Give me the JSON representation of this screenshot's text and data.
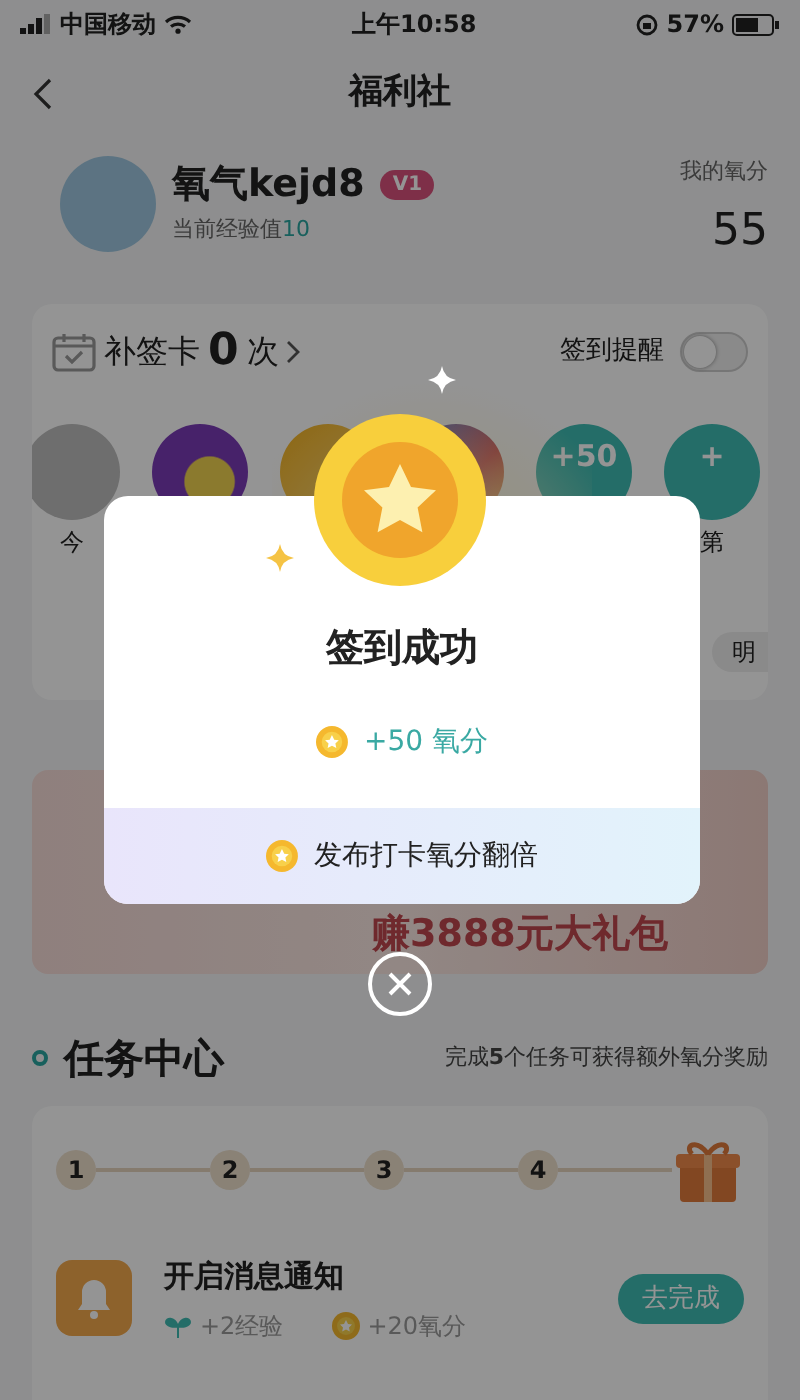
{
  "status_bar": {
    "carrier": "中国移动",
    "time": "上午10:58",
    "battery": "57%"
  },
  "nav": {
    "title": "福利社"
  },
  "profile": {
    "name": "氧气kejd8",
    "badge": "V1",
    "exp_label": "当前经验值",
    "exp_value": "10",
    "points_label": "我的氧分",
    "points": "55"
  },
  "checkin": {
    "makeup_label": "补签卡",
    "makeup_count": "0",
    "makeup_unit": "次",
    "reminder_label": "签到提醒",
    "reminder_on": false,
    "days": [
      {
        "kind": "gray",
        "label": "今"
      },
      {
        "kind": "purple"
      },
      {
        "kind": "coin"
      },
      {
        "kind": "colorful"
      },
      {
        "kind": "teal",
        "text": "+50"
      },
      {
        "kind": "teal",
        "text": "+",
        "label": "第"
      }
    ],
    "rules_chip": "明"
  },
  "banner": {
    "text": "赚3888元大礼包"
  },
  "tasks": {
    "title": "任务中心",
    "hint": "完成**5**个任务可获得额外氧分奖励",
    "steps": [
      "1",
      "2",
      "3",
      "4"
    ],
    "items": [
      {
        "title": "开启消息通知",
        "exp": "+2经验",
        "points": "+20氧分",
        "action": "去完成"
      }
    ]
  },
  "modal": {
    "title": "签到成功",
    "reward": "+50 氧分",
    "share": "发布打卡氧分翻倍"
  }
}
